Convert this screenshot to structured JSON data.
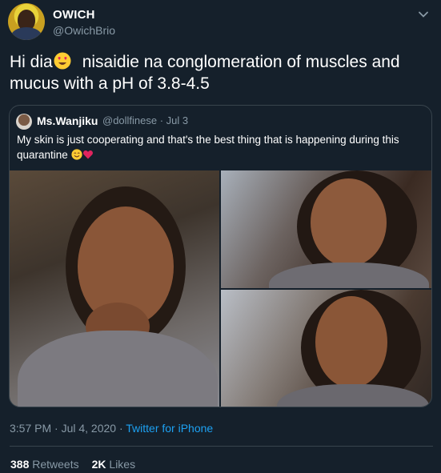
{
  "tweet": {
    "author": {
      "display_name": "OWICH",
      "handle": "@OwichBrio",
      "avatar_icon": "avatar-icon"
    },
    "text_before_emoji": "Hi dia",
    "emoji": "smiling-face-with-heart-eyes-icon",
    "text_after_emoji": "nisaidie na conglomeration of muscles and mucus with a pH of 3.8-4.5",
    "quoted": {
      "display_name": "Ms.Wanjiku",
      "meta": "@dollfinese · Jul 3",
      "text": "My skin is just cooperating and that's the best thing that is happening during this quarantine",
      "emojis": [
        "smiling-face-icon",
        "red-heart-icon"
      ],
      "photos": [
        "photo-woman-smiling-hand-on-chin",
        "photo-woman-smiling",
        "photo-woman-pouting"
      ]
    },
    "timestamp": "3:57 PM · Jul 4, 2020 · ",
    "source": "Twitter for iPhone",
    "retweets_count": "388",
    "retweets_label": "Retweets",
    "likes_count": "2K",
    "likes_label": "Likes"
  },
  "colors": {
    "background": "#15202b",
    "muted": "#8899a6",
    "accent": "#1da1f2",
    "border": "#38444d"
  }
}
